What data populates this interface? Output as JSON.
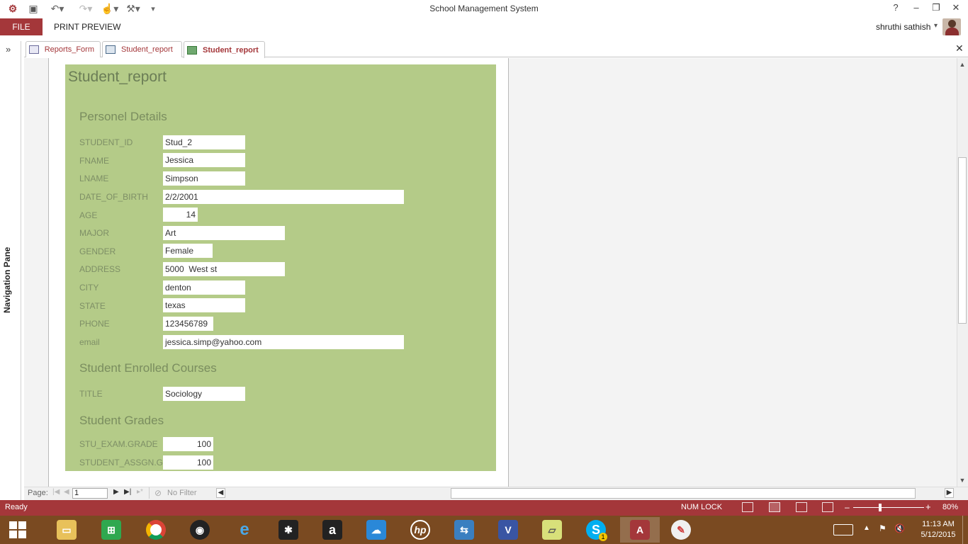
{
  "window": {
    "title": "School Management System",
    "help": "?",
    "minimize": "–",
    "restore": "❐",
    "close": "✕"
  },
  "ribbon": {
    "file_tab": "FILE",
    "print_preview_tab": "PRINT PREVIEW",
    "user_name": "shruthi sathish"
  },
  "nav_pane": {
    "label": "Navigation Pane",
    "expand": "»"
  },
  "doc_tabs": [
    {
      "label": "Reports_Form",
      "active": false
    },
    {
      "label": "Student_report",
      "active": false
    },
    {
      "label": "Student_report",
      "active": true
    }
  ],
  "doc_close": "✕",
  "report": {
    "title": "Student_report",
    "section_personal": "Personel Details",
    "fields": [
      {
        "label": "STUDENT_ID",
        "value": "Stud_2"
      },
      {
        "label": "FNAME",
        "value": "Jessica"
      },
      {
        "label": "LNAME",
        "value": "Simpson"
      },
      {
        "label": "DATE_OF_BIRTH",
        "value": "2/2/2001"
      },
      {
        "label": "AGE",
        "value": "14"
      },
      {
        "label": "MAJOR",
        "value": "Art"
      },
      {
        "label": "GENDER",
        "value": "Female"
      },
      {
        "label": "ADDRESS",
        "value": "5000  West st"
      },
      {
        "label": "CITY",
        "value": "denton"
      },
      {
        "label": "STATE",
        "value": "texas"
      },
      {
        "label": "PHONE",
        "value": "123456789"
      },
      {
        "label": "email",
        "value": "jessica.simp@yahoo.com"
      }
    ],
    "section_courses": "Student Enrolled Courses",
    "course": {
      "label": "TITLE",
      "value": "Sociology"
    },
    "section_grades": "Student Grades",
    "grades": [
      {
        "label": "STU_EXAM.GRADE",
        "value": "100"
      },
      {
        "label": "STUDENT_ASSGN.GR",
        "value": "100"
      }
    ]
  },
  "record_nav": {
    "page_label": "Page:",
    "page_value": "1",
    "filter": "No Filter"
  },
  "status": {
    "ready": "Ready",
    "num_lock": "NUM LOCK",
    "zoom": "80%",
    "zoom_minus": "–",
    "zoom_plus": "+"
  },
  "clock": {
    "time": "11:13 AM",
    "date": "5/12/2015"
  },
  "taskbar": {
    "apps": [
      "start-icon",
      "file-explorer-icon",
      "store-icon",
      "chrome-icon",
      "camera-icon",
      "ie-icon",
      "puzzle-icon",
      "amazon-icon",
      "onedrive-icon",
      "hp-icon",
      "network-icon",
      "visio-icon",
      "sticky-notes-icon",
      "skype-icon",
      "access-icon",
      "paint-icon"
    ],
    "skype_badge": "1"
  },
  "colors": {
    "accent": "#a4373a",
    "report_bg": "#b4cb88",
    "taskbar": "#7a4a21"
  }
}
